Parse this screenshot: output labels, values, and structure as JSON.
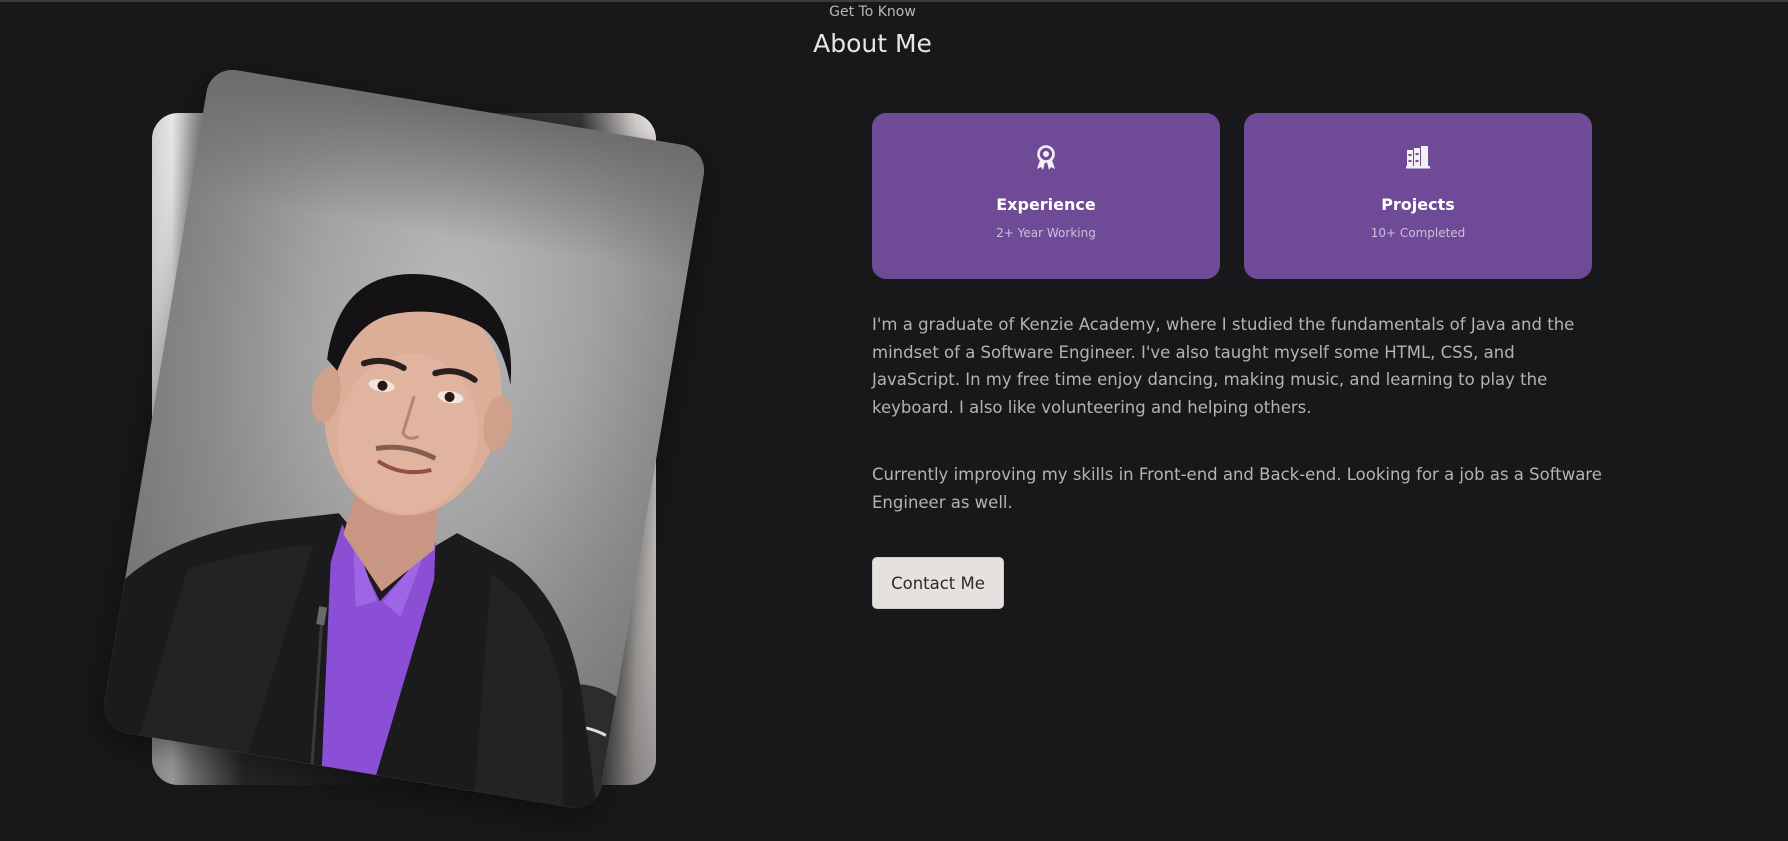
{
  "header": {
    "eyebrow": "Get To Know",
    "title": "About Me"
  },
  "photo": {
    "alt": "Profile photo",
    "shirt_color": "#8b4fd6"
  },
  "cards": [
    {
      "icon": "award-icon",
      "title": "Experience",
      "subtitle": "2+ Year Working"
    },
    {
      "icon": "books-icon",
      "title": "Projects",
      "subtitle": "10+ Completed"
    }
  ],
  "about": {
    "paragraph1": "I'm a graduate of Kenzie Academy, where I studied the fundamentals of Java and the mindset of a Software Engineer. I've also taught myself some HTML, CSS, and JavaScript. In my free time enjoy dancing, making music, and learning to play the keyboard. I also like volunteering and helping others.",
    "paragraph2": "Currently improving my skills in Front-end and Back-end. Looking for a job as a Software Engineer as well."
  },
  "cta": {
    "contact_label": "Contact Me"
  },
  "colors": {
    "background": "#18181a",
    "card": "#6f4a96",
    "text": "#b3b3b3",
    "button": "#e4e1df"
  }
}
